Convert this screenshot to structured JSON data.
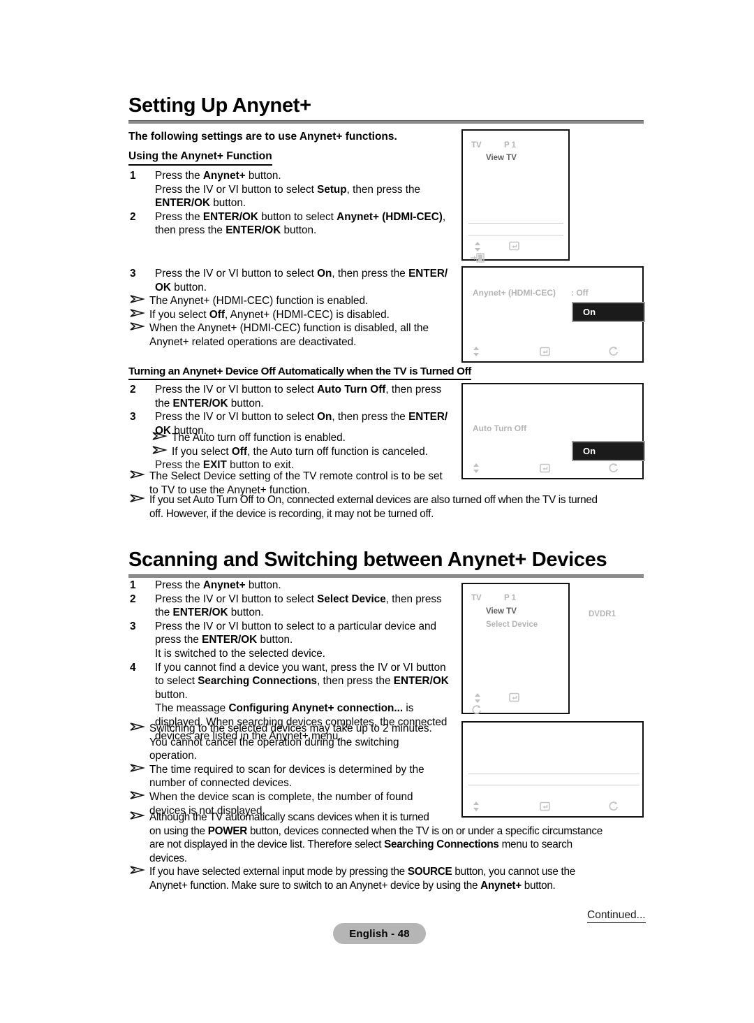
{
  "sections": [
    {
      "id": "setting-up-anynet",
      "title": "Setting Up Anynet+",
      "intro": "The following settings are to use Anynet+ functions.",
      "subhead": "Using the Anynet+ Function"
    },
    {
      "id": "scanning-switching",
      "title": "Scanning and Switching between Anynet+ Devices"
    }
  ],
  "subhead_auto_turn_off": "Turning an Anynet+ Device Off Automatically when the TV is Turned Off",
  "steps_using": [
    {
      "num": "1",
      "lines": [
        "Press the <b>Anynet+</b> button.",
        "Press the IV or VI button to select <b>Setup</b>, then press the",
        "<b>ENTER/OK</b> button."
      ]
    },
    {
      "num": "2",
      "lines": [
        "Press the <b>ENTER/OK</b> button to select <b>Anynet+ (HDMI-CEC)</b>,",
        "then press the <b>ENTER/OK</b> button."
      ]
    }
  ],
  "steps_using_3": {
    "num": "3",
    "lines": [
      "Press the IV or VI button to select <b>On</b>, then press the <b>ENTER/</b>",
      "<b>OK</b> button."
    ]
  },
  "notes_using": [
    "The Anynet+ (HDMI-CEC) function is enabled.",
    "If you select <b>Off</b>, Anynet+ (HDMI-CEC) is disabled.",
    "When the Anynet+ (HDMI-CEC) function is disabled, all the<br>Anynet+ related operations are deactivated."
  ],
  "steps_auto": [
    {
      "num": "2",
      "lines": [
        "Press the IV or VI button to select <b>Auto Turn Off</b>, then press",
        "the <b>ENTER/OK</b> button."
      ]
    },
    {
      "num": "3",
      "lines": [
        "Press the IV or VI button to select <b>On</b>, then press the <b>ENTER/</b>",
        "<b>OK</b> button."
      ]
    }
  ],
  "notes_auto_indent": [
    "The Auto turn off function is enabled.",
    "If you select <b>Off</b>, the Auto turn off function is canceled."
  ],
  "auto_exit_line": "Press the <b>EXIT</b> button to exit.",
  "notes_auto": [
    "The Select Device setting of the TV remote control is to be set<br>to TV to use the Anynet+ function.",
    "If you set Auto Turn Off to On, connected external devices are also turned off when the TV is turned<br>off. However, if the device is recording, it may not be turned off."
  ],
  "steps_scanning": [
    {
      "num": "1",
      "lines": [
        "Press the <b>Anynet+</b> button."
      ]
    },
    {
      "num": "2",
      "lines": [
        "Press the IV or VI button to select <b>Select Device</b>, then press",
        "the <b>ENTER/OK</b> button."
      ]
    },
    {
      "num": "3",
      "lines": [
        "Press the IV or VI button to select to a particular device and",
        "press the <b>ENTER/OK</b> button.",
        "It is switched to the selected device."
      ]
    },
    {
      "num": "4",
      "lines": [
        "If you cannot find a device you want, press the IV or VI button",
        "to select <b>Searching Connections</b>, then press the <b>ENTER/OK</b>",
        "button.",
        "The meassage <b>Configuring Anynet+ connection...</b> is",
        "displayed. When searching devices completes, the connected",
        "devices are listed in the Anynet+ menu."
      ]
    }
  ],
  "notes_scanning": [
    "Switching to the selected devices may take up to 2 minutes.<br>You cannot cancel the operation during the switching<br>operation.",
    "The time required to scan for devices is determined by the<br>number of connected devices.",
    "When the device scan is complete, the number of found<br>devices is not displayed."
  ],
  "notes_scanning_wide": [
    "Although the TV automatically scans devices when it is turned<br>on using the <b>POWER</b> button, devices connected when the TV is on or under a specific circumstance<br>are not displayed in the device list. Therefore select <b>Searching Connections</b> menu to search<br>devices.",
    "If you have selected external input mode by pressing the <b>SOURCE</b> button, you cannot use the<br>Anynet+ function. Make sure to switch to an Anynet+ device by using the <b>Anynet+</b> button."
  ],
  "osd": {
    "box1": {
      "source": "TV",
      "channel": "P 1",
      "item_view_tv": "View TV"
    },
    "box2": {
      "setting_label": "Anynet+ (HDMI-CEC)",
      "setting_value": ": Off",
      "highlight": "On"
    },
    "box3": {
      "setting_label": "Auto Turn Off",
      "highlight": "On"
    },
    "box4": {
      "source": "TV",
      "channel": "P 1",
      "item_view_tv": "View TV",
      "item_select_device": "Select Device",
      "device_name": "DVDR1"
    }
  },
  "footer": {
    "page_label": "English - 48",
    "continued": "Continued..."
  },
  "colors": {
    "rule": "#8a8a8a",
    "osd_text": "#b4b4b4",
    "osd_text_dark": "#5f5f5f",
    "highlight_bg": "#1b1b1b",
    "pill_bg": "#b5b5b5"
  }
}
